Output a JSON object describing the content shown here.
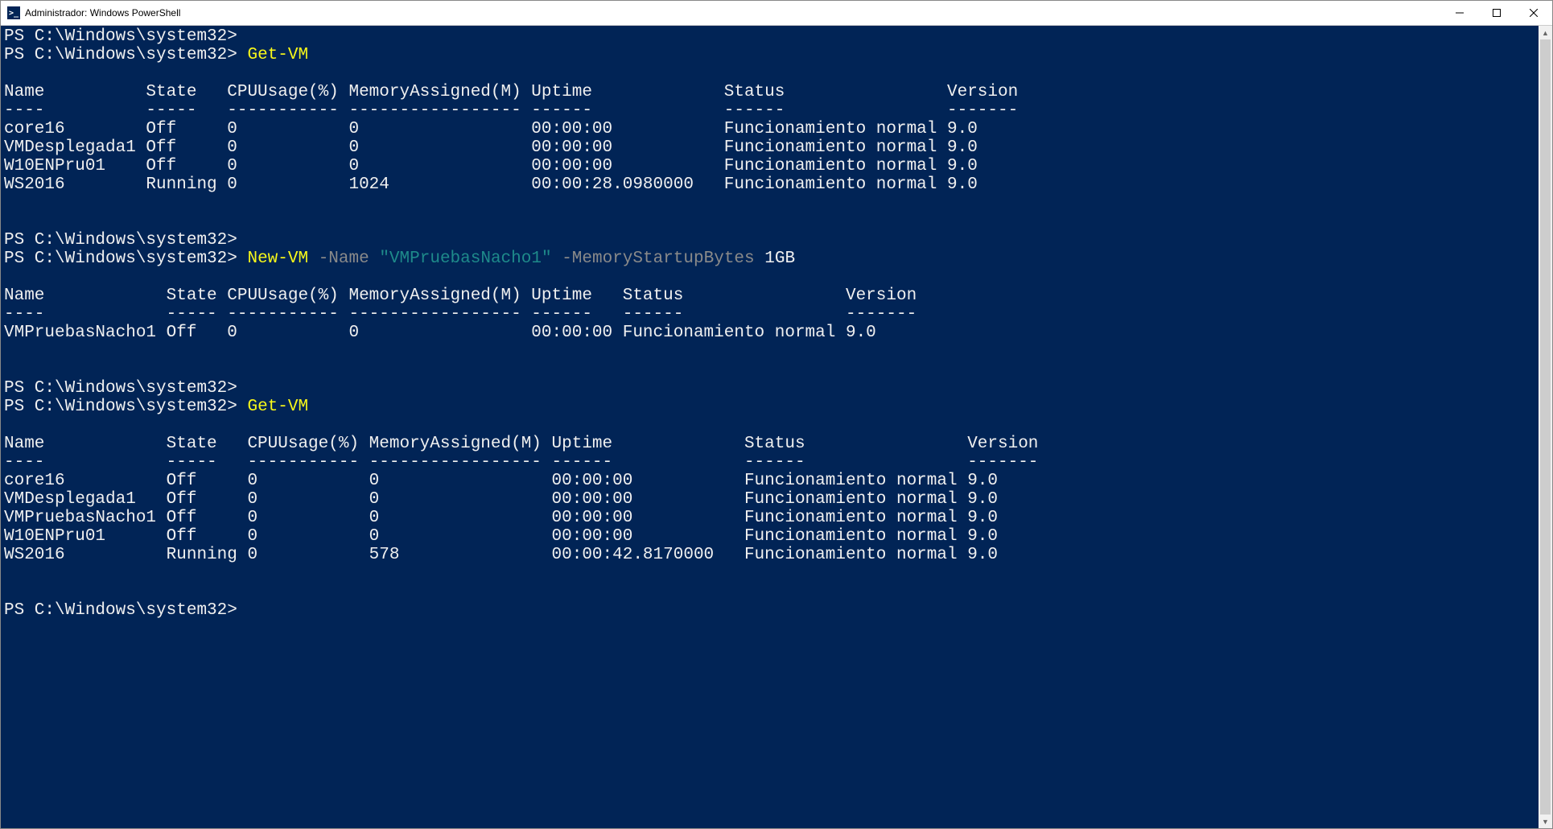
{
  "window": {
    "title": "Administrador: Windows PowerShell"
  },
  "prompt": "PS C:\\Windows\\system32>",
  "cmds": {
    "getvm": "Get-VM",
    "newvm_cmd": "New-VM",
    "newvm_p1": "-Name",
    "newvm_val": "\"VMPruebasNacho1\"",
    "newvm_p2": "-MemoryStartupBytes",
    "newvm_bytes": "1GB"
  },
  "headers1": {
    "line": "Name          State   CPUUsage(%) MemoryAssigned(M) Uptime             Status                Version",
    "under": "----          -----   ----------- ----------------- ------             ------                -------"
  },
  "rows1": [
    "core16        Off     0           0                 00:00:00           Funcionamiento normal 9.0",
    "VMDesplegada1 Off     0           0                 00:00:00           Funcionamiento normal 9.0",
    "W10ENPru01    Off     0           0                 00:00:00           Funcionamiento normal 9.0",
    "WS2016        Running 0           1024              00:00:28.0980000   Funcionamiento normal 9.0"
  ],
  "headers2": {
    "line": "Name            State CPUUsage(%) MemoryAssigned(M) Uptime   Status                Version",
    "under": "----            ----- ----------- ----------------- ------   ------                -------"
  },
  "rows2": [
    "VMPruebasNacho1 Off   0           0                 00:00:00 Funcionamiento normal 9.0"
  ],
  "headers3": {
    "line": "Name            State   CPUUsage(%) MemoryAssigned(M) Uptime             Status                Version",
    "under": "----            -----   ----------- ----------------- ------             ------                -------"
  },
  "rows3": [
    "core16          Off     0           0                 00:00:00           Funcionamiento normal 9.0",
    "VMDesplegada1   Off     0           0                 00:00:00           Funcionamiento normal 9.0",
    "VMPruebasNacho1 Off     0           0                 00:00:00           Funcionamiento normal 9.0",
    "W10ENPru01      Off     0           0                 00:00:00           Funcionamiento normal 9.0",
    "WS2016          Running 0           578               00:00:42.8170000   Funcionamiento normal 9.0"
  ]
}
